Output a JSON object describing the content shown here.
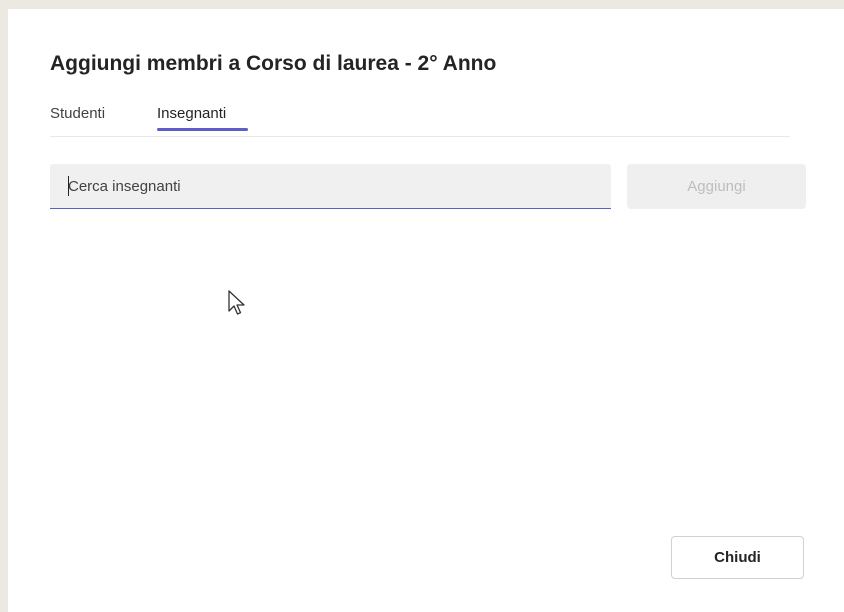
{
  "dialog": {
    "title": "Aggiungi membri a Corso di laurea - 2° Anno",
    "tabs": [
      {
        "label": "Studenti",
        "selected": false
      },
      {
        "label": "Insegnanti",
        "selected": true
      }
    ],
    "search": {
      "value": "",
      "placeholder": "Cerca insegnanti"
    },
    "add_label": "Aggiungi",
    "close_label": "Chiudi"
  },
  "colors": {
    "accent": "#5b5fc7",
    "background": "#ebe9e1",
    "dialog": "#ffffff"
  },
  "icons": {
    "pointer": "mouse-pointer-icon"
  }
}
